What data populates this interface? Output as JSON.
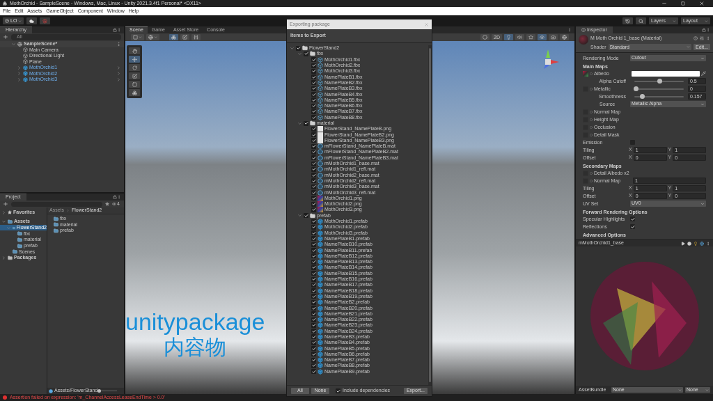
{
  "title_bar": {
    "title": "MothOrchid - SampleScene - Windows, Mac, Linux - Unity 2021.3.4f1 Personal* <DX11>"
  },
  "menu": [
    "File",
    "Edit",
    "Assets",
    "GameObject",
    "Component",
    "Window",
    "Help"
  ],
  "toolbar": {
    "account": "LO",
    "layers": "Layers",
    "layout": "Layout"
  },
  "hierarchy": {
    "title": "Hierarchy",
    "search_placeholder": "All",
    "items": [
      {
        "label": "SampleScene*",
        "kind": "scene",
        "expanded": true,
        "selected": false,
        "children": [
          {
            "label": "Main Camera",
            "kind": "object",
            "selected": false
          },
          {
            "label": "Directional Light",
            "kind": "object",
            "selected": false
          },
          {
            "label": "Plane",
            "kind": "object",
            "selected": false
          },
          {
            "label": "MothOrchid1",
            "kind": "prefab",
            "expanded": false,
            "selected": false
          },
          {
            "label": "MothOrchid2",
            "kind": "prefab",
            "expanded": false,
            "selected": false
          },
          {
            "label": "MothOrchid3",
            "kind": "prefab",
            "expanded": false,
            "selected": false
          }
        ]
      }
    ]
  },
  "project": {
    "title": "Project",
    "hidden_count": "4",
    "favorites": {
      "label": "Favorites",
      "expanded": false
    },
    "tree": [
      {
        "label": "Assets",
        "expanded": true,
        "selected": false,
        "children": [
          {
            "label": "FlowerStand2",
            "expanded": true,
            "selected": true,
            "children": [
              {
                "label": "fbx",
                "selected": false
              },
              {
                "label": "material",
                "selected": false
              },
              {
                "label": "prefab",
                "selected": false
              }
            ]
          },
          {
            "label": "Scenes",
            "selected": false
          }
        ]
      },
      {
        "label": "Packages",
        "expanded": false,
        "kind": "plain",
        "selected": false
      }
    ],
    "breadcrumb": [
      "Assets",
      "FlowerStand2"
    ],
    "files": [
      "fbx",
      "material",
      "prefab"
    ],
    "footer_path": "Assets/FlowerStand",
    "thumbnail_size": {
      "level": 0
    }
  },
  "scene": {
    "tabs": [
      {
        "label": "Scene",
        "selected": true
      },
      {
        "label": "Game",
        "selected": false
      },
      {
        "label": "Asset Store",
        "selected": false
      },
      {
        "label": "Console",
        "selected": false
      }
    ],
    "mode_2d": "2D",
    "caption": [
      "unitypackage",
      "内容物"
    ]
  },
  "dialog": {
    "title": "Exporting package",
    "heading": "Items to Export",
    "tree": [
      {
        "label": "FlowerStand2",
        "kind": "folder",
        "checked": true,
        "expanded": true,
        "children": [
          {
            "label": "fbx",
            "kind": "folder",
            "checked": true,
            "expanded": true,
            "children": [
              {
                "label": "MothOrchid1.fbx",
                "kind": "model",
                "checked": true
              },
              {
                "label": "MothOrchid2.fbx",
                "kind": "model",
                "checked": true
              },
              {
                "label": "MothOrchid3.fbx",
                "kind": "model",
                "checked": true
              },
              {
                "label": "NamePlateB1.fbx",
                "kind": "model",
                "checked": true
              },
              {
                "label": "NamePlateB2.fbx",
                "kind": "model",
                "checked": true
              },
              {
                "label": "NamePlateB3.fbx",
                "kind": "model",
                "checked": true
              },
              {
                "label": "NamePlateB4.fbx",
                "kind": "model",
                "checked": true
              },
              {
                "label": "NamePlateB5.fbx",
                "kind": "model",
                "checked": true
              },
              {
                "label": "NamePlateB6.fbx",
                "kind": "model",
                "checked": true
              },
              {
                "label": "NamePlateB7.fbx",
                "kind": "model",
                "checked": true
              },
              {
                "label": "NamePlateB8.fbx",
                "kind": "model",
                "checked": true
              }
            ]
          },
          {
            "label": "material",
            "kind": "folder",
            "checked": true,
            "expanded": true,
            "children": [
              {
                "label": "FlowerStand_NamePlateB.png",
                "kind": "texture",
                "checked": true
              },
              {
                "label": "FlowerStand_NamePlateB2.png",
                "kind": "texture",
                "checked": true
              },
              {
                "label": "FlowerStand_NamePlateB3.png",
                "kind": "texture",
                "checked": true
              },
              {
                "label": "mFlowerStand_NamePlateB.mat",
                "kind": "material",
                "checked": true
              },
              {
                "label": "mFlowerStand_NamePlateB2.mat",
                "kind": "material",
                "checked": true
              },
              {
                "label": "mFlowerStand_NamePlateB3.mat",
                "kind": "material",
                "checked": true
              },
              {
                "label": "mMothOrchid1_base.mat",
                "kind": "material",
                "checked": true
              },
              {
                "label": "mMothOrchid1_refl.mat",
                "kind": "material",
                "checked": true
              },
              {
                "label": "mMothOrchid2_base.mat",
                "kind": "material",
                "checked": true
              },
              {
                "label": "mMothOrchid2_refl.mat",
                "kind": "material",
                "checked": true
              },
              {
                "label": "mMothOrchid3_base.mat",
                "kind": "material",
                "checked": true
              },
              {
                "label": "mMothOrchid3_refl.mat",
                "kind": "material",
                "checked": true
              },
              {
                "label": "MothOrchid1.png",
                "kind": "image",
                "checked": true
              },
              {
                "label": "MothOrchid2.png",
                "kind": "image",
                "checked": true
              },
              {
                "label": "MothOrchid3.png",
                "kind": "image",
                "checked": true
              }
            ]
          },
          {
            "label": "prefab",
            "kind": "folder",
            "checked": true,
            "expanded": true,
            "children": [
              {
                "label": "MothOrchid1.prefab",
                "kind": "prefab",
                "checked": true
              },
              {
                "label": "MothOrchid2.prefab",
                "kind": "prefab",
                "checked": true
              },
              {
                "label": "MothOrchid3.prefab",
                "kind": "prefab",
                "checked": true
              },
              {
                "label": "NamePlateB1.prefab",
                "kind": "prefab",
                "checked": true
              },
              {
                "label": "NamePlateB10.prefab",
                "kind": "prefab",
                "checked": true
              },
              {
                "label": "NamePlateB11.prefab",
                "kind": "prefab",
                "checked": true
              },
              {
                "label": "NamePlateB12.prefab",
                "kind": "prefab",
                "checked": true
              },
              {
                "label": "NamePlateB13.prefab",
                "kind": "prefab",
                "checked": true
              },
              {
                "label": "NamePlateB14.prefab",
                "kind": "prefab",
                "checked": true
              },
              {
                "label": "NamePlateB15.prefab",
                "kind": "prefab",
                "checked": true
              },
              {
                "label": "NamePlateB16.prefab",
                "kind": "prefab",
                "checked": true
              },
              {
                "label": "NamePlateB17.prefab",
                "kind": "prefab",
                "checked": true
              },
              {
                "label": "NamePlateB18.prefab",
                "kind": "prefab",
                "checked": true
              },
              {
                "label": "NamePlateB19.prefab",
                "kind": "prefab",
                "checked": true
              },
              {
                "label": "NamePlateB2.prefab",
                "kind": "prefab",
                "checked": true
              },
              {
                "label": "NamePlateB20.prefab",
                "kind": "prefab",
                "checked": true
              },
              {
                "label": "NamePlateB21.prefab",
                "kind": "prefab",
                "checked": true
              },
              {
                "label": "NamePlateB22.prefab",
                "kind": "prefab",
                "checked": true
              },
              {
                "label": "NamePlateB23.prefab",
                "kind": "prefab",
                "checked": true
              },
              {
                "label": "NamePlateB24.prefab",
                "kind": "prefab",
                "checked": true
              },
              {
                "label": "NamePlateB3.prefab",
                "kind": "prefab",
                "checked": true
              },
              {
                "label": "NamePlateB4.prefab",
                "kind": "prefab",
                "checked": true
              },
              {
                "label": "NamePlateB5.prefab",
                "kind": "prefab",
                "checked": true
              },
              {
                "label": "NamePlateB6.prefab",
                "kind": "prefab",
                "checked": true
              },
              {
                "label": "NamePlateB7.prefab",
                "kind": "prefab",
                "checked": true
              },
              {
                "label": "NamePlateB8.prefab",
                "kind": "prefab",
                "checked": true
              },
              {
                "label": "NamePlateB9.prefab",
                "kind": "prefab",
                "checked": true
              }
            ]
          }
        ]
      }
    ],
    "buttons": {
      "all": "All",
      "none": "None",
      "export": "Export..."
    },
    "include_dependencies": {
      "label": "Include dependencies",
      "checked": true
    }
  },
  "inspector": {
    "title": "Inspector",
    "material": "M Moth Orchid 1_base (Material)",
    "shader_label": "Shader",
    "shader": "Standard",
    "edit": "Edit...",
    "rows": [
      {
        "kind": "dropdown",
        "label": "Rendering Mode",
        "value": "Cutout"
      },
      {
        "kind": "heading",
        "label": "Main Maps"
      },
      {
        "kind": "albedo",
        "label": "Albedo"
      },
      {
        "kind": "slider",
        "label": "Alpha Cutoff",
        "level": 0.5,
        "value": "0.5"
      },
      {
        "kind": "texture-slider",
        "label": "Metallic",
        "level": 0,
        "value": "0"
      },
      {
        "kind": "slider",
        "label": "Smoothness",
        "level": 0.157,
        "value": "0.157"
      },
      {
        "kind": "sub-dropdown",
        "label": "Source",
        "value": "Metallic Alpha"
      },
      {
        "kind": "texture",
        "label": "Normal Map"
      },
      {
        "kind": "texture",
        "label": "Height Map"
      },
      {
        "kind": "texture",
        "label": "Occlusion"
      },
      {
        "kind": "texture",
        "label": "Detail Mask"
      },
      {
        "kind": "toggle",
        "label": "Emission",
        "checked": false
      },
      {
        "kind": "xy",
        "label": "Tiling",
        "fields": [
          {
            "axis": "X",
            "value": "1"
          },
          {
            "axis": "Y",
            "value": "1"
          }
        ]
      },
      {
        "kind": "xy",
        "label": "Offset",
        "fields": [
          {
            "axis": "X",
            "value": "0"
          },
          {
            "axis": "Y",
            "value": "0"
          }
        ]
      },
      {
        "kind": "heading",
        "label": "Secondary Maps"
      },
      {
        "kind": "texture",
        "label": "Detail Albedo x2"
      },
      {
        "kind": "texture-field",
        "label": "Normal Map",
        "value": "1"
      },
      {
        "kind": "xy",
        "label": "Tiling",
        "fields": [
          {
            "axis": "X",
            "value": "1"
          },
          {
            "axis": "Y",
            "value": "1"
          }
        ]
      },
      {
        "kind": "xy",
        "label": "Offset",
        "fields": [
          {
            "axis": "X",
            "value": "0"
          },
          {
            "axis": "Y",
            "value": "0"
          }
        ]
      },
      {
        "kind": "dropdown",
        "label": "UV Set",
        "value": "UV0"
      },
      {
        "kind": "heading",
        "label": "Forward Rendering Options"
      },
      {
        "kind": "toggle",
        "label": "Specular Highlights",
        "checked": true
      },
      {
        "kind": "toggle",
        "label": "Reflections",
        "checked": true
      },
      {
        "kind": "heading",
        "label": "Advanced Options"
      }
    ],
    "preview_title": "mMothOrchid1_base",
    "asset_bundle": {
      "label": "AssetBundle",
      "value": "None",
      "variant": "None"
    }
  },
  "status_bar": {
    "message": "Assertion failed on expression: 'm_ChannelAccessLeaseEndTime > 0.0'"
  }
}
